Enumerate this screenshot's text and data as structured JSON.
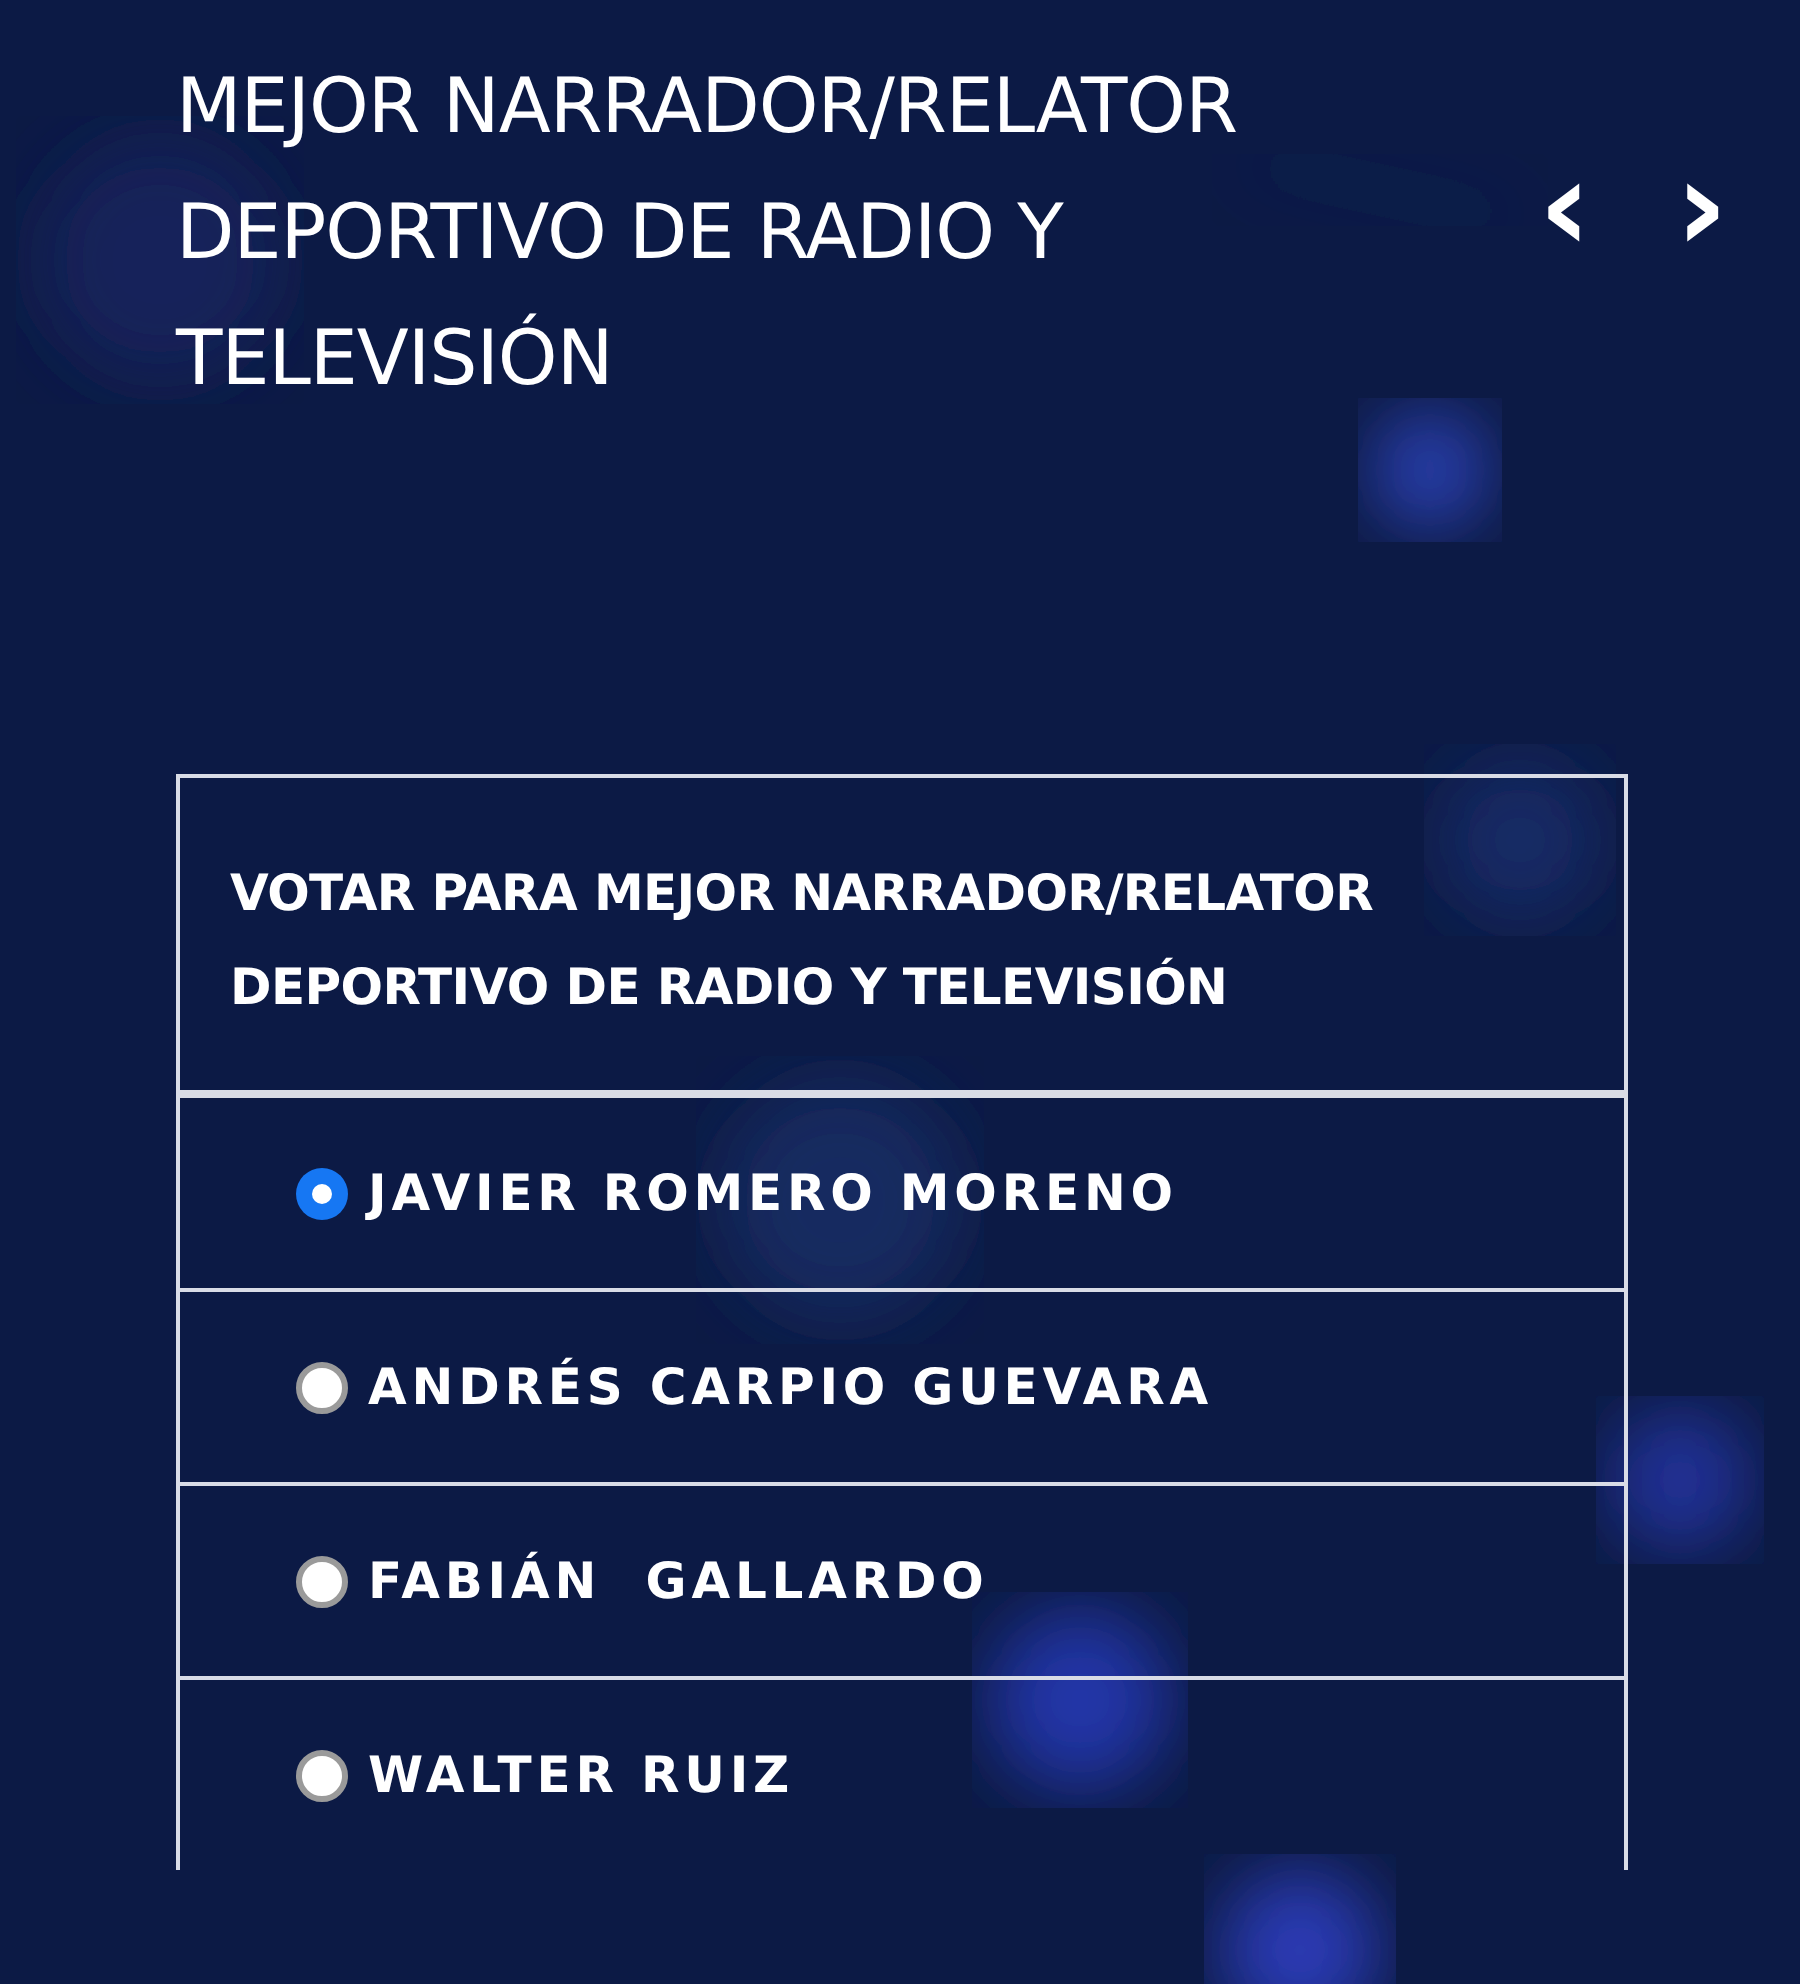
{
  "category_title": "MEJOR NARRADOR/RELATOR DEPORTIVO DE RADIO Y TELEVISIÓN",
  "nav": {
    "prev": "‹",
    "next": "›"
  },
  "vote_card": {
    "heading": "VOTAR PARA MEJOR NARRADOR/RELATOR DEPORTIVO DE RADIO Y TELEVISIÓN",
    "options": [
      {
        "label": "JAVIER ROMERO MORENO",
        "selected": true
      },
      {
        "label": "ANDRÉS CARPIO GUEVARA",
        "selected": false
      },
      {
        "label": "FABIÁN  GALLARDO",
        "selected": false
      },
      {
        "label": "WALTER RUIZ",
        "selected": false
      }
    ]
  }
}
